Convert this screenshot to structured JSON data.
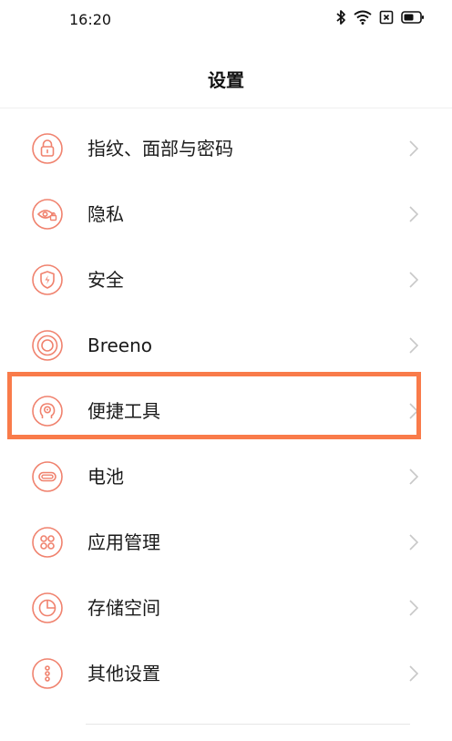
{
  "status_bar": {
    "time": "16:20",
    "icons": [
      "bluetooth-icon",
      "wifi-icon",
      "sim-icon",
      "battery-icon"
    ]
  },
  "header": {
    "title": "设置"
  },
  "accent_color": "#f0826e",
  "highlight_color": "#f97b4a",
  "settings": {
    "items": [
      {
        "label": "指纹、面部与密码",
        "icon": "lock-icon"
      },
      {
        "label": "隐私",
        "icon": "eye-lock-icon"
      },
      {
        "label": "安全",
        "icon": "shield-bolt-icon"
      },
      {
        "label": "Breeno",
        "icon": "breeno-rings-icon"
      },
      {
        "label": "便捷工具",
        "icon": "convenience-tools-icon",
        "highlighted": true
      },
      {
        "label": "电池",
        "icon": "battery-capsule-icon"
      },
      {
        "label": "应用管理",
        "icon": "apps-grid-icon"
      },
      {
        "label": "存储空间",
        "icon": "storage-pie-icon"
      },
      {
        "label": "其他设置",
        "icon": "more-dots-icon"
      }
    ]
  }
}
